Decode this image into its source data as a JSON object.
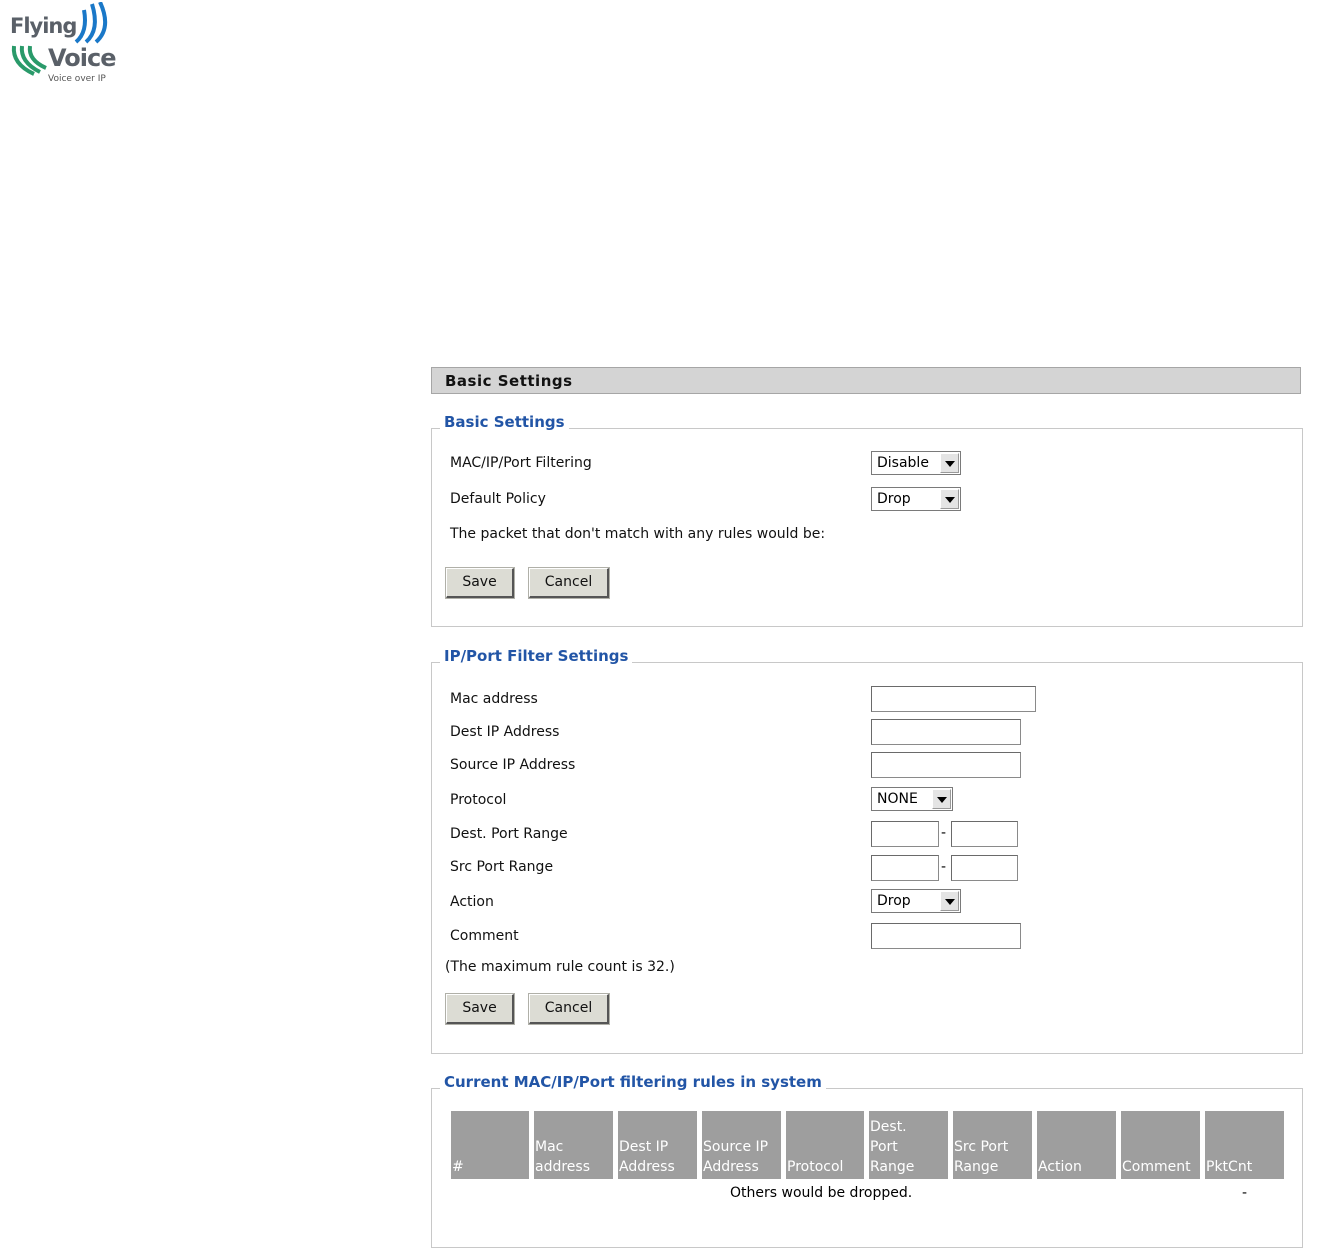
{
  "logo": {
    "line1": "Flying",
    "line2": "Voice",
    "tagline": "Voice over IP"
  },
  "header": {
    "title": "Basic Settings"
  },
  "basic": {
    "legend": "Basic Settings",
    "filtering_label": "MAC/IP/Port Filtering",
    "filtering_value": "Disable",
    "policy_label": "Default Policy",
    "policy_value": "Drop",
    "note": "The packet that don't match with any rules would be:",
    "save": "Save",
    "cancel": "Cancel"
  },
  "filter": {
    "legend": "IP/Port Filter Settings",
    "mac_label": "Mac address",
    "dest_ip_label": "Dest IP Address",
    "src_ip_label": "Source IP Address",
    "protocol_label": "Protocol",
    "protocol_value": "NONE",
    "dest_port_label": "Dest. Port Range",
    "src_port_label": "Src Port Range",
    "action_label": "Action",
    "action_value": "Drop",
    "comment_label": "Comment",
    "max_note": "(The maximum rule count is 32.)",
    "range_sep": "-",
    "save": "Save",
    "cancel": "Cancel"
  },
  "rules": {
    "legend": "Current MAC/IP/Port filtering rules in system",
    "columns": [
      "#",
      "Mac\naddress",
      "Dest IP\nAddress",
      "Source IP\nAddress",
      "Protocol",
      "Dest.\nPort\nRange",
      "Src Port\nRange",
      "Action",
      "Comment",
      "PktCnt"
    ],
    "others_text": "Others would be dropped.",
    "others_pkt": "-"
  },
  "colors": {
    "legend": "#2255a6",
    "header_bg": "#d4d4d4",
    "table_head_bg": "#9e9e9e",
    "logo_blue": "#1a78c8"
  }
}
